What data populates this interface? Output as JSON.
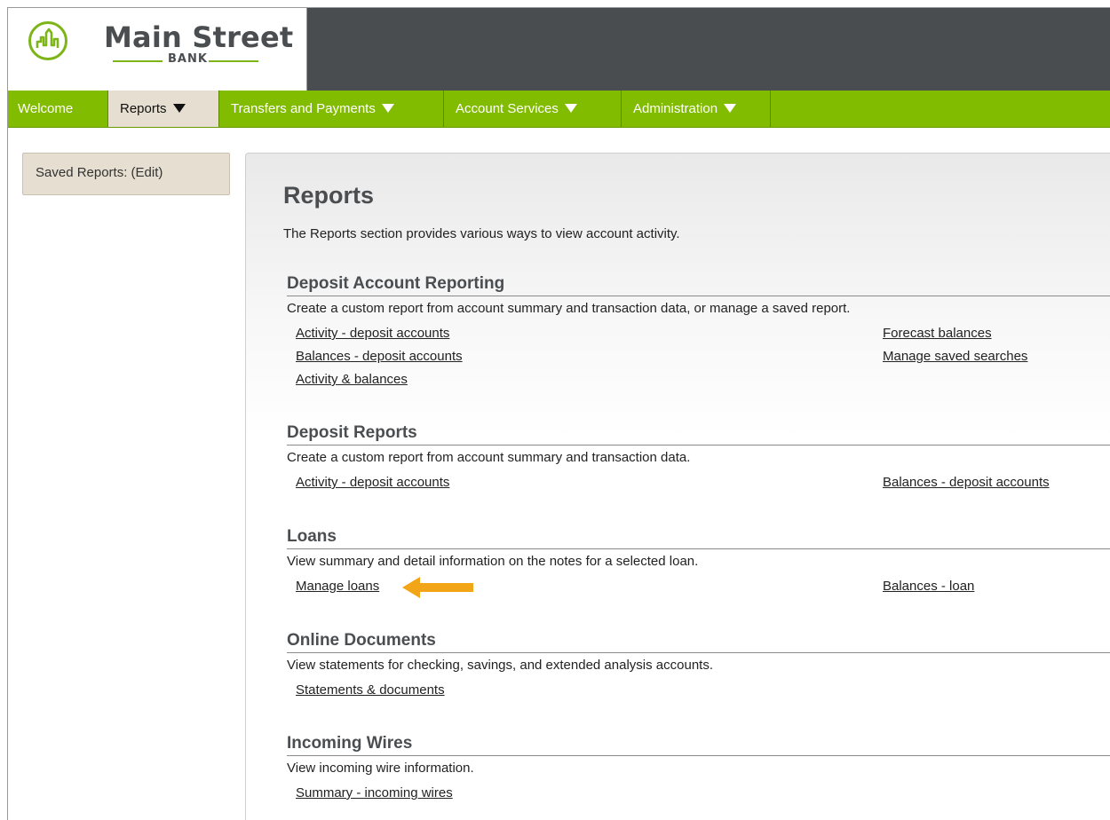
{
  "logo": {
    "name": "Main Street",
    "sub": "BANK",
    "accent": "#7db518"
  },
  "nav": {
    "items": [
      {
        "label": "Welcome",
        "dropdown": false,
        "active": false
      },
      {
        "label": "Reports",
        "dropdown": true,
        "active": true
      },
      {
        "label": "Transfers and Payments",
        "dropdown": true,
        "active": false
      },
      {
        "label": "Account Services",
        "dropdown": true,
        "active": false
      },
      {
        "label": "Administration",
        "dropdown": true,
        "active": false
      }
    ],
    "color": "#82bc00"
  },
  "sidebar": {
    "saved_reports_label": "Saved Reports: (Edit)"
  },
  "main": {
    "title": "Reports",
    "description": "The Reports section provides various ways to view account activity.",
    "sections": [
      {
        "title": "Deposit Account Reporting",
        "description": "Create a custom report from account summary and transaction data, or manage a saved report.",
        "left_links": [
          "Activity - deposit accounts",
          "Balances - deposit accounts",
          "Activity & balances"
        ],
        "right_links": [
          "Forecast balances",
          "Manage saved searches"
        ]
      },
      {
        "title": "Deposit Reports",
        "description": "Create a custom report from account summary and transaction data.",
        "left_links": [
          "Activity - deposit accounts"
        ],
        "right_links": [
          "Balances - deposit accounts"
        ]
      },
      {
        "title": "Loans",
        "description": "View summary and detail information on the notes for a selected loan.",
        "left_links": [
          "Manage loans"
        ],
        "right_links": [
          "Balances - loan"
        ]
      },
      {
        "title": "Online Documents",
        "description": "View statements for checking, savings, and extended analysis accounts.",
        "left_links": [
          "Statements & documents"
        ],
        "right_links": []
      },
      {
        "title": "Incoming Wires",
        "description": "View incoming wire information.",
        "left_links": [
          "Summary - incoming wires"
        ],
        "right_links": []
      }
    ]
  },
  "annotation": {
    "icon": "arrow-left-icon",
    "color": "#f2a516"
  }
}
